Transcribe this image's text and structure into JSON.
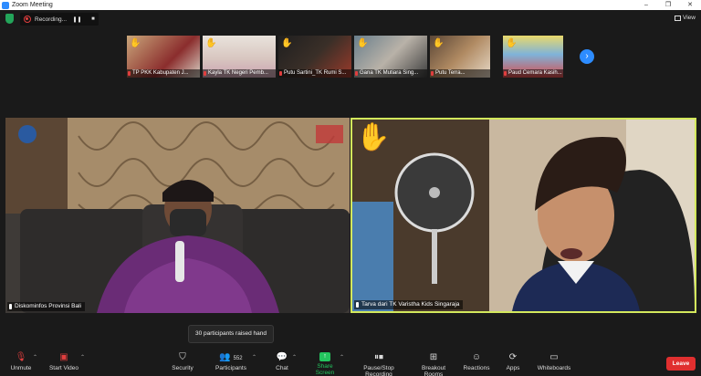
{
  "window": {
    "title": "Zoom Meeting",
    "controls": [
      "–",
      "❐",
      "✕"
    ]
  },
  "status": {
    "recording_label": "Recording...",
    "pause_icon": "pause-icon",
    "stop_icon": "stop-icon",
    "view_label": "View"
  },
  "thumbnails": [
    {
      "name": "TP PKK Kabupaten J...",
      "hand": true
    },
    {
      "name": "Kayla TK Negeri Pemb...",
      "hand": true
    },
    {
      "name": "Putu Sartini_TK Rumi S...",
      "hand": true
    },
    {
      "name": "Gana  TK Mutiara Sing...",
      "hand": true
    },
    {
      "name": "Putu Terra...",
      "hand": true
    },
    {
      "name": "Paud Cemara Kasih...",
      "hand": true
    }
  ],
  "videos": {
    "left": {
      "name": "Diskominfos Provinsi Bali"
    },
    "right": {
      "name": "Tarva dari TK Varistha Kids Singaraja",
      "hand": true
    }
  },
  "tooltip": "30 participants raised hand",
  "toolbar": {
    "unmute": "Unmute",
    "start_video": "Start Video",
    "security": "Security",
    "participants": "Participants",
    "participants_count": "552",
    "chat": "Chat",
    "share_screen": "Share Screen",
    "pause_stop_recording": "Pause/Stop Recording",
    "breakout_rooms": "Breakout Rooms",
    "reactions": "Reactions",
    "apps": "Apps",
    "whiteboards": "Whiteboards",
    "leave": "Leave"
  },
  "colors": {
    "accent": "#2d8cff",
    "active_speaker": "#d3e85c",
    "leave": "#e02f2f",
    "hand": "#f5b400",
    "record": "#e03e3e"
  }
}
